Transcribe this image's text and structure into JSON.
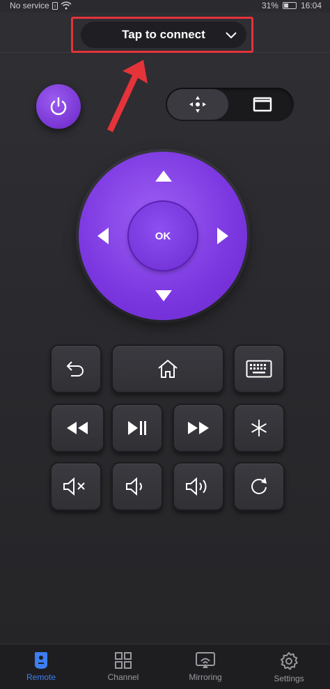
{
  "status_bar": {
    "carrier": "No service",
    "battery": "31%",
    "time": "16:04"
  },
  "header": {
    "connect_label": "Tap to connect"
  },
  "colors": {
    "accent": "#7a36df",
    "nav_active": "#3d7ef0",
    "highlight": "#e5333a"
  },
  "dpad": {
    "ok_label": "OK"
  },
  "icons": {
    "power": "power-icon",
    "mode_dpad": "dpad-move-icon",
    "mode_touch": "touchpad-icon",
    "row1": [
      "back-icon",
      "home-icon",
      "keyboard-icon"
    ],
    "row2": [
      "rewind-icon",
      "play-pause-icon",
      "fast-forward-icon",
      "asterisk-icon"
    ],
    "row3": [
      "mute-icon",
      "volume-down-icon",
      "volume-up-icon",
      "replay-icon"
    ]
  },
  "bottom_nav": {
    "items": [
      {
        "label": "Remote",
        "icon": "remote-icon",
        "active": true
      },
      {
        "label": "Channel",
        "icon": "grid-icon",
        "active": false
      },
      {
        "label": "Mirroring",
        "icon": "cast-icon",
        "active": false
      },
      {
        "label": "Settings",
        "icon": "gear-icon",
        "active": false
      }
    ]
  }
}
